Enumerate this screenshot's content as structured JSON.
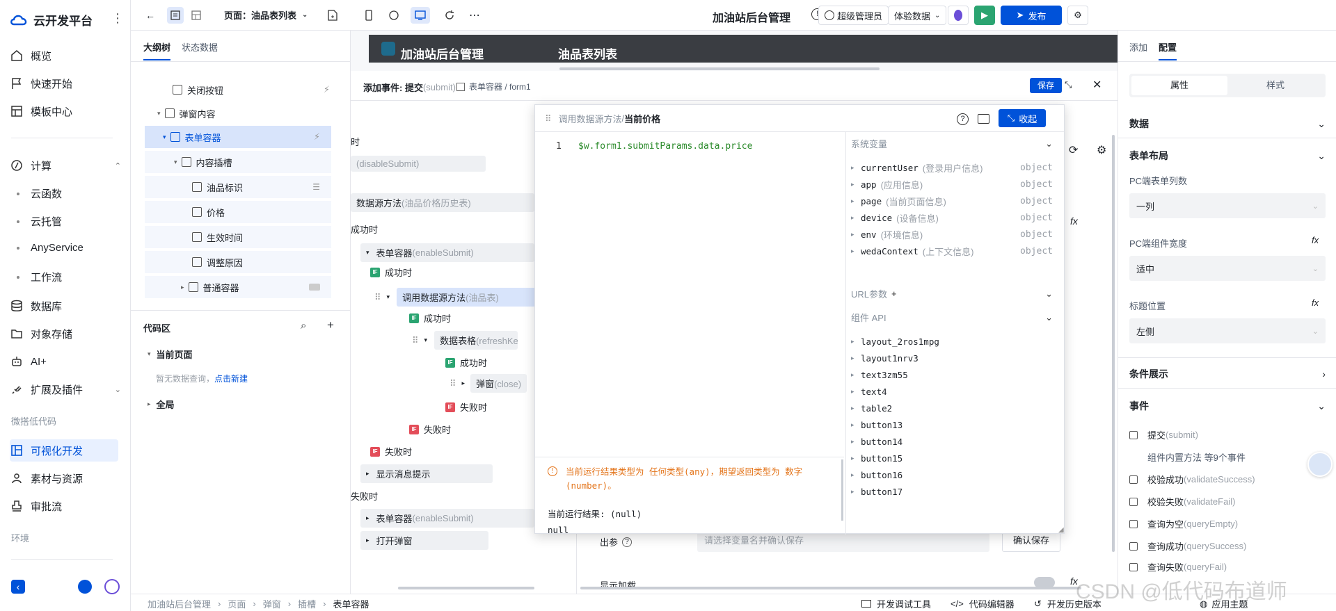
{
  "brand": {
    "name": "云开发平台"
  },
  "nav": {
    "items": [
      {
        "label": "概览",
        "icon": "home-icon"
      },
      {
        "label": "快速开始",
        "icon": "flag-icon"
      },
      {
        "label": "模板中心",
        "icon": "template-icon"
      }
    ],
    "compute": {
      "label": "计算",
      "subs": [
        "云函数",
        "云托管",
        "AnyService",
        "工作流"
      ]
    },
    "items2": [
      {
        "label": "数据库"
      },
      {
        "label": "对象存储"
      },
      {
        "label": "AI+"
      },
      {
        "label": "扩展及插件"
      }
    ],
    "caption_lowcode": "微搭低代码",
    "items3": [
      {
        "label": "可视化开发"
      },
      {
        "label": "素材与资源"
      },
      {
        "label": "审批流"
      }
    ],
    "caption_env": "环境"
  },
  "topbar": {
    "page_label": "页面：油品表列表",
    "app_title": "加油站后台管理",
    "user": "超级管理员",
    "env": "体验数据",
    "publish": "发布"
  },
  "outline": {
    "tabs": [
      "大纲树",
      "状态数据"
    ],
    "tree": [
      "关闭按钮",
      "弹窗内容",
      "表单容器",
      "内容插槽",
      "油品标识",
      "价格",
      "生效时间",
      "调整原因",
      "普通容器"
    ],
    "code_title": "代码区",
    "current_page": "当前页面",
    "empty_hint": "暂无数据查询，",
    "create_link": "点击新建",
    "global": "全局"
  },
  "canvas": {
    "preview_left": "加油站后台管理",
    "preview_right": "油品表列表",
    "add_event": "添加事件: 提交",
    "add_event_code": "(submit)",
    "path": "表单容器 / form1",
    "save": "保存",
    "when": "时",
    "disable_submit": "(disableSubmit)",
    "ds_method": "数据源方法",
    "ds_history": "(油品价格历史表)",
    "on_success": "成功时",
    "form_container": "表单容器",
    "enable_submit": "(enableSubmit)",
    "if_success": "成功时",
    "call_ds": "调用数据源方法",
    "call_ds_sub": "(油品表)",
    "data_table": "数据表格",
    "refresh": "(refreshKee",
    "popup": "弹窗",
    "close": "(close)",
    "if_fail": "失败时",
    "show_msg": "显示消息提示",
    "on_fail": "失败时",
    "open_popup": "打开弹窗",
    "out_param": "出参",
    "out_placeholder": "请选择变量名并确认保存",
    "confirm_save": "确认保存",
    "show_loading": "显示加载"
  },
  "modal": {
    "crumb": "调用数据源方法",
    "title": "当前价格",
    "collapse": "收起",
    "line_no": "1",
    "code": "$w.form1.submitParams.data.price",
    "sys_vars": "系统变量",
    "vars": [
      {
        "name": "currentUser",
        "desc": "(登录用户信息)",
        "type": "object"
      },
      {
        "name": "app",
        "desc": "(应用信息)",
        "type": "object"
      },
      {
        "name": "page",
        "desc": "(当前页面信息)",
        "type": "object"
      },
      {
        "name": "device",
        "desc": "(设备信息)",
        "type": "object"
      },
      {
        "name": "env",
        "desc": "(环境信息)",
        "type": "object"
      },
      {
        "name": "wedaContext",
        "desc": "(上下文信息)",
        "type": "object"
      }
    ],
    "url_params": "URL参数",
    "component_api": "组件 API",
    "components": [
      "layout_2ros1mpg",
      "layout1nrv3",
      "text3zm55",
      "text4",
      "table2",
      "button13",
      "button14",
      "button15",
      "button16",
      "button17"
    ],
    "warning": "当前运行结果类型为 任何类型(any)，期望返回类型为 数字(number)。",
    "result_label": "当前运行结果: (null)",
    "null_text": "null"
  },
  "rightpanel": {
    "tabs": [
      "添加",
      "配置"
    ],
    "seg": [
      "属性",
      "样式"
    ],
    "data": "数据",
    "form_layout": "表单布局",
    "pc_cols_label": "PC端表单列数",
    "pc_cols": "一列",
    "pc_width_label": "PC端组件宽度",
    "pc_width": "适中",
    "title_pos_label": "标题位置",
    "title_pos": "左侧",
    "cond_display": "条件展示",
    "events": "事件",
    "event_list": [
      {
        "label": "提交",
        "code": "(submit)"
      },
      {
        "label": "校验成功",
        "code": "(validateSuccess)"
      },
      {
        "label": "校验失败",
        "code": "(validateFail)"
      },
      {
        "label": "查询为空",
        "code": "(queryEmpty)"
      },
      {
        "label": "查询成功",
        "code": "(querySuccess)"
      },
      {
        "label": "查询失败",
        "code": "(queryFail)"
      }
    ],
    "builtin": "组件内置方法 等9个事件"
  },
  "bottombar": {
    "crumbs": [
      "加油站后台管理",
      "页面",
      "弹窗",
      "插槽",
      "表单容器"
    ],
    "dev_tools": "开发调试工具",
    "code_editor": "代码编辑器",
    "history": "开发历史版本",
    "theme": "应用主题"
  },
  "watermark": "CSDN @低代码布道师",
  "colors": {
    "primary": "#0052d9",
    "success": "#2ba471",
    "danger": "#e34d59",
    "warning": "#e37318"
  }
}
